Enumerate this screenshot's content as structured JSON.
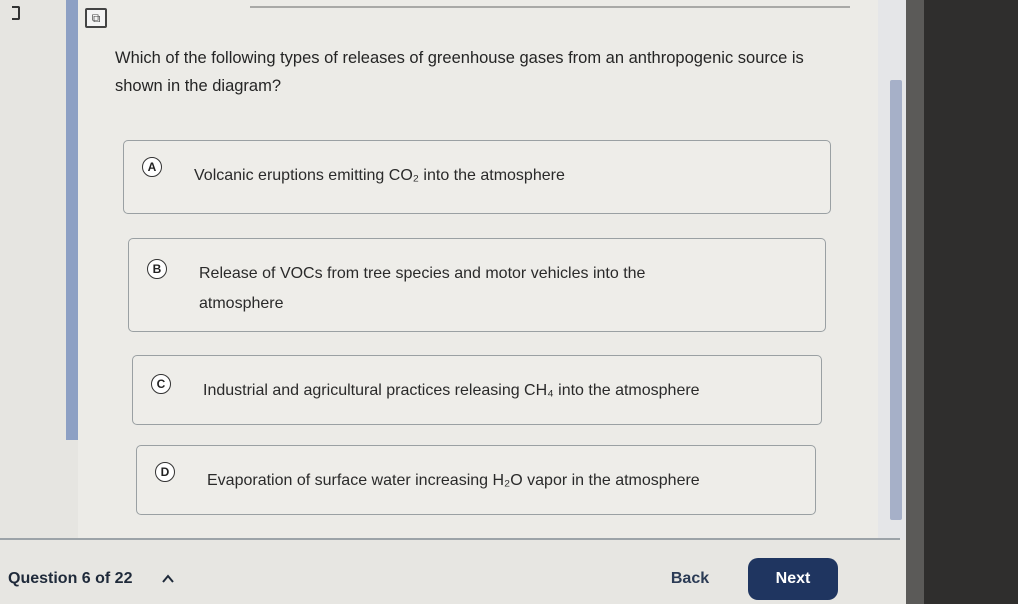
{
  "question": {
    "text": "Which of the following types of releases of greenhouse gases from an anthropogenic source is shown in the diagram?"
  },
  "options": [
    {
      "letter": "A",
      "text": "Volcanic eruptions emitting CO₂ into the atmosphere"
    },
    {
      "letter": "B",
      "text": "Release of VOCs from tree species and motor vehicles into the atmosphere"
    },
    {
      "letter": "C",
      "text": "Industrial and agricultural practices releasing CH₄ into the atmosphere"
    },
    {
      "letter": "D",
      "text": "Evaporation of surface water increasing H₂O vapor in the atmosphere"
    }
  ],
  "footer": {
    "counter": "Question 6 of 22",
    "back_label": "Back",
    "next_label": "Next"
  },
  "icons": {
    "toolbar": "reference-sheet-icon",
    "chevron": "chevron-up-icon"
  }
}
